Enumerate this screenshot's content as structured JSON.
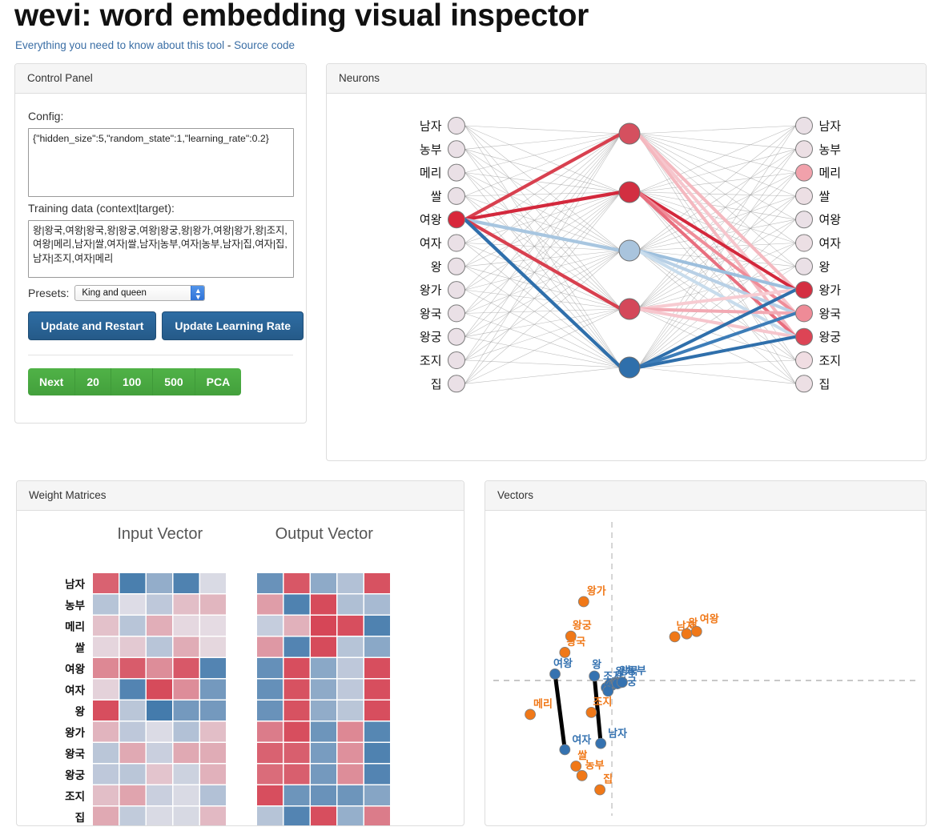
{
  "header": {
    "title": "wevi: word embedding visual inspector",
    "link_primary": "Everything you need to know about this tool",
    "link_separator": " - ",
    "link_secondary": "Source code"
  },
  "control_panel": {
    "heading": "Control Panel",
    "config_label": "Config:",
    "config_value": "{\"hidden_size\":5,\"random_state\":1,\"learning_rate\":0.2}",
    "training_label": "Training data (context|target):",
    "training_value": "왕|왕국,여왕|왕국,왕|왕궁,여왕|왕궁,왕|왕가,여왕|왕가,왕|조지,여왕|메리,남자|쌀,여자|쌀,남자|농부,여자|농부,남자|집,여자|집,남자|조지,여자|메리",
    "presets_label": "Presets:",
    "presets_selected": "King and queen",
    "presets_options": [
      "King and queen"
    ],
    "update_restart_label": "Update and Restart",
    "update_learning_rate_label": "Update Learning Rate",
    "step_buttons": [
      "Next",
      "20",
      "100",
      "500",
      "PCA"
    ]
  },
  "neurons": {
    "heading": "Neurons",
    "input_labels": [
      "남자",
      "농부",
      "메리",
      "쌀",
      "여왕",
      "여자",
      "왕",
      "왕가",
      "왕국",
      "왕궁",
      "조지",
      "집"
    ],
    "output_labels": [
      "남자",
      "농부",
      "메리",
      "쌀",
      "여왕",
      "여자",
      "왕",
      "왕가",
      "왕국",
      "왕궁",
      "조지",
      "집"
    ],
    "hidden_count": 5,
    "active_input_index": 4,
    "input_fills": [
      "#eae0e6",
      "#eae0e6",
      "#eae0e6",
      "#eae0e6",
      "#d8273b",
      "#eae0e6",
      "#eae0e6",
      "#eae0e6",
      "#eae0e6",
      "#eae0e6",
      "#eae0e6",
      "#eae0e6"
    ],
    "hidden_fills": [
      "#d5505f",
      "#d22f41",
      "#a9c4dd",
      "#d4485a",
      "#2f6fab"
    ],
    "output_fills": [
      "#eae0e6",
      "#ecdfe4",
      "#f1a1ab",
      "#ecdfe4",
      "#eae0e6",
      "#ecdfe4",
      "#eae0e6",
      "#d42f41",
      "#ee8b97",
      "#dd4455",
      "#f0dde2",
      "#ecdfe4"
    ],
    "colors": {
      "positive": "#d42f41",
      "negative": "#2f6fab",
      "neutral_edge": "#8c8c8c"
    }
  },
  "weight_matrices": {
    "heading": "Weight Matrices",
    "input_title": "Input Vector",
    "output_title": "Output Vector",
    "row_labels": [
      "남자",
      "농부",
      "메리",
      "쌀",
      "여왕",
      "여자",
      "왕",
      "왕가",
      "왕국",
      "왕궁",
      "조지",
      "집"
    ],
    "columns": 5,
    "color_scale": {
      "max_positive": "#d53e4f",
      "max_negative": "#2e6da4",
      "zero": "#e6e2e9"
    },
    "input_matrix": [
      [
        0.78,
        -0.85,
        -0.45,
        -0.82,
        -0.07
      ],
      [
        -0.26,
        -0.05,
        -0.22,
        0.22,
        0.27
      ],
      [
        0.2,
        -0.25,
        0.32,
        0.06,
        0.04
      ],
      [
        0.08,
        0.15,
        -0.25,
        0.33,
        0.07
      ],
      [
        0.55,
        0.82,
        0.52,
        0.84,
        -0.8
      ],
      [
        0.1,
        -0.8,
        0.92,
        0.52,
        -0.62
      ],
      [
        0.9,
        -0.24,
        -0.88,
        -0.62,
        -0.62
      ],
      [
        0.28,
        -0.22,
        -0.06,
        -0.28,
        0.22
      ],
      [
        -0.24,
        0.35,
        -0.16,
        0.35,
        0.33
      ],
      [
        -0.22,
        -0.24,
        0.18,
        -0.14,
        0.3
      ],
      [
        0.22,
        0.38,
        -0.16,
        -0.07,
        -0.28
      ],
      [
        0.35,
        -0.2,
        -0.07,
        -0.08,
        0.25
      ]
    ],
    "output_matrix": [
      [
        -0.68,
        0.85,
        -0.48,
        -0.28,
        0.88
      ],
      [
        0.42,
        -0.82,
        0.92,
        -0.3,
        -0.34
      ],
      [
        -0.18,
        0.3,
        0.95,
        0.9,
        -0.82
      ],
      [
        0.45,
        -0.8,
        0.92,
        -0.26,
        -0.5
      ],
      [
        -0.7,
        0.9,
        -0.5,
        -0.22,
        0.9
      ],
      [
        -0.7,
        0.88,
        -0.48,
        -0.22,
        0.9
      ],
      [
        -0.68,
        0.88,
        -0.46,
        -0.24,
        0.9
      ],
      [
        0.62,
        0.9,
        -0.66,
        0.55,
        -0.78
      ],
      [
        0.78,
        0.8,
        -0.6,
        0.5,
        -0.82
      ],
      [
        0.72,
        0.8,
        -0.62,
        0.52,
        -0.8
      ],
      [
        0.9,
        -0.66,
        -0.68,
        -0.66,
        -0.52
      ],
      [
        -0.26,
        -0.8,
        0.9,
        -0.44,
        0.62
      ]
    ]
  },
  "vectors": {
    "heading": "Vectors",
    "colors": {
      "input": "#3572b0",
      "output": "#f07818",
      "axis": "#c8c8c8",
      "link": "#000000"
    },
    "axis": {
      "vertical_x": 0.0,
      "horizontal_y": 0.0,
      "grid": "dashed-crosshair"
    },
    "input_points": [
      {
        "label": "여왕",
        "x": 0.148,
        "y": 0.52,
        "label_dx": -2,
        "label_dy": -9
      },
      {
        "label": "여자",
        "x": 0.171,
        "y": 0.776,
        "label_dx": 9,
        "label_dy": -8
      },
      {
        "label": "왕",
        "x": 0.24,
        "y": 0.527,
        "label_dx": -3,
        "label_dy": -10
      },
      {
        "label": "남자",
        "x": 0.255,
        "y": 0.755,
        "label_dx": 9,
        "label_dy": -8
      },
      {
        "label": "조지",
        "x": 0.268,
        "y": 0.566,
        "label_dx": -4,
        "label_dy": -10
      },
      {
        "label": "메리",
        "x": 0.276,
        "y": 0.555,
        "label_dx": -4,
        "label_dy": 2
      },
      {
        "label": "쌀",
        "x": 0.281,
        "y": 0.558,
        "label_dx": 2,
        "label_dy": 2
      },
      {
        "label": "왕가",
        "x": 0.289,
        "y": 0.551,
        "label_dx": 0,
        "label_dy": -10
      },
      {
        "label": "왕국",
        "x": 0.292,
        "y": 0.549,
        "label_dx": 3,
        "label_dy": -10
      },
      {
        "label": "왕궁",
        "x": 0.294,
        "y": 0.553,
        "label_dx": 0,
        "label_dy": 2
      },
      {
        "label": "농부",
        "x": 0.305,
        "y": 0.548,
        "label_dx": 6,
        "label_dy": -10
      },
      {
        "label": "집",
        "x": 0.272,
        "y": 0.578,
        "label_dx": -6,
        "label_dy": 2
      }
    ],
    "output_points": [
      {
        "label": "왕가",
        "x": 0.215,
        "y": 0.275,
        "label_dx": 4,
        "label_dy": -9
      },
      {
        "label": "왕궁",
        "x": 0.185,
        "y": 0.392,
        "label_dx": 2,
        "label_dy": -9
      },
      {
        "label": "왕국",
        "x": 0.171,
        "y": 0.447,
        "label_dx": 2,
        "label_dy": -9
      },
      {
        "label": "메리",
        "x": 0.09,
        "y": 0.657,
        "label_dx": 4,
        "label_dy": -9
      },
      {
        "label": "조지",
        "x": 0.233,
        "y": 0.65,
        "label_dx": 2,
        "label_dy": -9
      },
      {
        "label": "쌀",
        "x": 0.197,
        "y": 0.832,
        "label_dx": 2,
        "label_dy": -9
      },
      {
        "label": "농부",
        "x": 0.211,
        "y": 0.864,
        "label_dx": 4,
        "label_dy": -9
      },
      {
        "label": "집",
        "x": 0.253,
        "y": 0.912,
        "label_dx": 4,
        "label_dy": -9
      },
      {
        "label": "남자",
        "x": 0.428,
        "y": 0.394,
        "label_dx": 2,
        "label_dy": -9
      },
      {
        "label": "왕",
        "x": 0.456,
        "y": 0.384,
        "label_dx": 2,
        "label_dy": -9
      },
      {
        "label": "여왕",
        "x": 0.479,
        "y": 0.376,
        "label_dx": 4,
        "label_dy": -11
      }
    ],
    "links": [
      {
        "from": "여왕",
        "to": "여자"
      },
      {
        "from": "왕",
        "to": "남자"
      }
    ]
  }
}
